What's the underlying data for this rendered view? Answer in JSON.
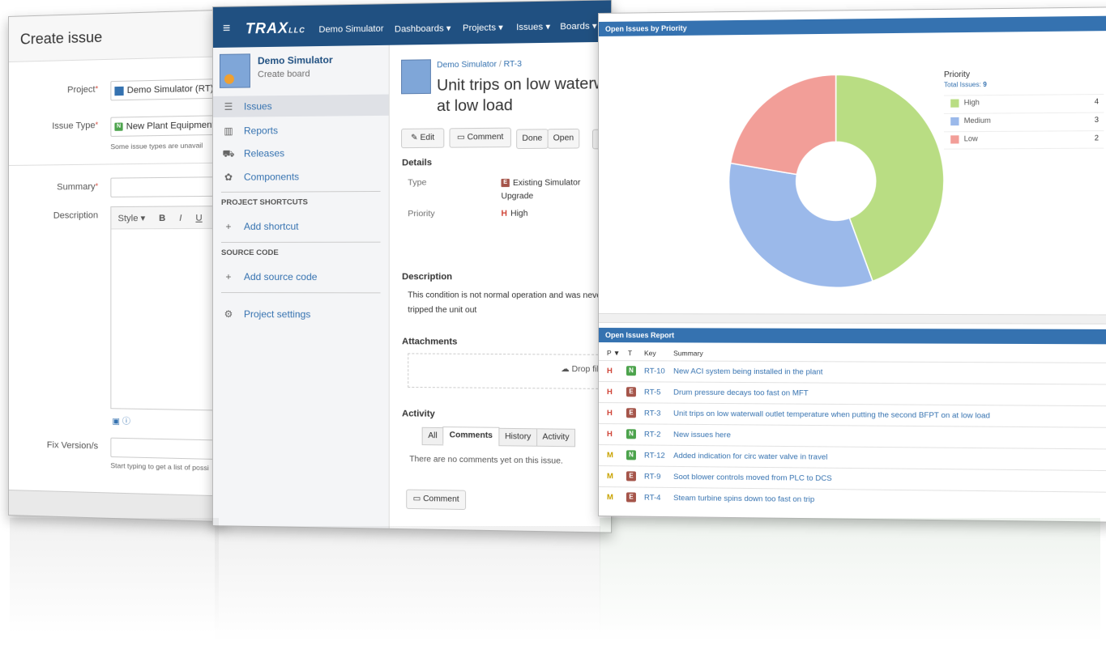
{
  "create_issue": {
    "title": "Create issue",
    "project_label": "Project",
    "project_value": "Demo Simulator (RT)",
    "project_icon": "project-avatar",
    "issue_type_label": "Issue Type",
    "issue_type_value": "New Plant Equipment",
    "issue_type_badge": "N",
    "issue_type_hint": "Some issue types are unavail",
    "summary_label": "Summary",
    "description_label": "Description",
    "toolbar": {
      "style": "Style ▾",
      "bold": "B",
      "italic": "I",
      "underline": "U"
    },
    "fix_version_label": "Fix Version/s",
    "fix_version_hint": "Start typing to get a list of possi"
  },
  "app": {
    "menu_icon": "≡",
    "logo": "TRAX",
    "logo_suffix": "LLC",
    "nav": [
      "Demo Simulator",
      "Dashboards ▾",
      "Projects ▾",
      "Issues ▾",
      "Boards ▾"
    ]
  },
  "sidebar": {
    "project_name": "Demo Simulator",
    "project_sub": "Create board",
    "items": [
      {
        "label": "Issues",
        "icon": "issues-icon"
      },
      {
        "label": "Reports",
        "icon": "reports-icon"
      },
      {
        "label": "Releases",
        "icon": "releases-icon"
      },
      {
        "label": "Components",
        "icon": "components-icon"
      }
    ],
    "shortcuts_heading": "PROJECT SHORTCUTS",
    "add_shortcut": "Add shortcut",
    "source_heading": "SOURCE CODE",
    "add_source": "Add source code",
    "settings": "Project settings"
  },
  "issue": {
    "breadcrumb_project": "Demo Simulator",
    "breadcrumb_sep": "/",
    "breadcrumb_key": "RT-3",
    "title_line1": "Unit trips on low waterwall",
    "title_line2": "at low load",
    "actions": {
      "edit": "Edit",
      "comment": "Comment",
      "done": "Done",
      "open": "Open",
      "more": "A"
    },
    "details_heading": "Details",
    "type_label": "Type",
    "type_value_1": "Existing Simulator",
    "type_value_2": "Upgrade",
    "type_badge": "E",
    "priority_label": "Priority",
    "priority_value": "High",
    "priority_badge": "H",
    "description_heading": "Description",
    "description_1": "This condition is not normal operation and was never",
    "description_2": "tripped the unit out",
    "attachments_heading": "Attachments",
    "drop_files": "Drop files i",
    "activity_heading": "Activity",
    "tabs": [
      "All",
      "Comments",
      "History",
      "Activity"
    ],
    "no_comments": "There are no comments yet on this issue.",
    "comment_button": "Comment"
  },
  "priority_chart": {
    "header": "Open Issues by Priority",
    "legend_title": "Priority",
    "total_label": "Total Issues:",
    "total_value": "9"
  },
  "chart_data": {
    "type": "pie",
    "title": "Open Issues by Priority",
    "categories": [
      "High",
      "Medium",
      "Low"
    ],
    "values": [
      4,
      3,
      2
    ],
    "colors": [
      "#b9dd83",
      "#9bb9ea",
      "#f29e98"
    ],
    "legend": "right"
  },
  "report": {
    "header": "Open Issues Report",
    "columns": [
      "P",
      "T",
      "Key",
      "Summary"
    ],
    "rows": [
      {
        "p": "H",
        "t": "N",
        "key": "RT-10",
        "summary": "New ACI system being installed in the plant"
      },
      {
        "p": "H",
        "t": "E",
        "key": "RT-5",
        "summary": "Drum pressure decays too fast on MFT"
      },
      {
        "p": "H",
        "t": "E",
        "key": "RT-3",
        "summary": "Unit trips on low waterwall outlet temperature when putting the second BFPT on at low load"
      },
      {
        "p": "H",
        "t": "N",
        "key": "RT-2",
        "summary": "New issues here"
      },
      {
        "p": "M",
        "t": "N",
        "key": "RT-12",
        "summary": "Added indication for circ water valve in travel"
      },
      {
        "p": "M",
        "t": "E",
        "key": "RT-9",
        "summary": "Soot blower controls moved from PLC to DCS"
      },
      {
        "p": "M",
        "t": "E",
        "key": "RT-4",
        "summary": "Steam turbine spins down too fast on trip"
      }
    ]
  },
  "colors": {
    "nav": "#205081",
    "link": "#3572b0",
    "high": "#d04437",
    "medium": "#c8a200",
    "new_badge": "#4ca34c",
    "existing_badge": "#a5554a"
  }
}
